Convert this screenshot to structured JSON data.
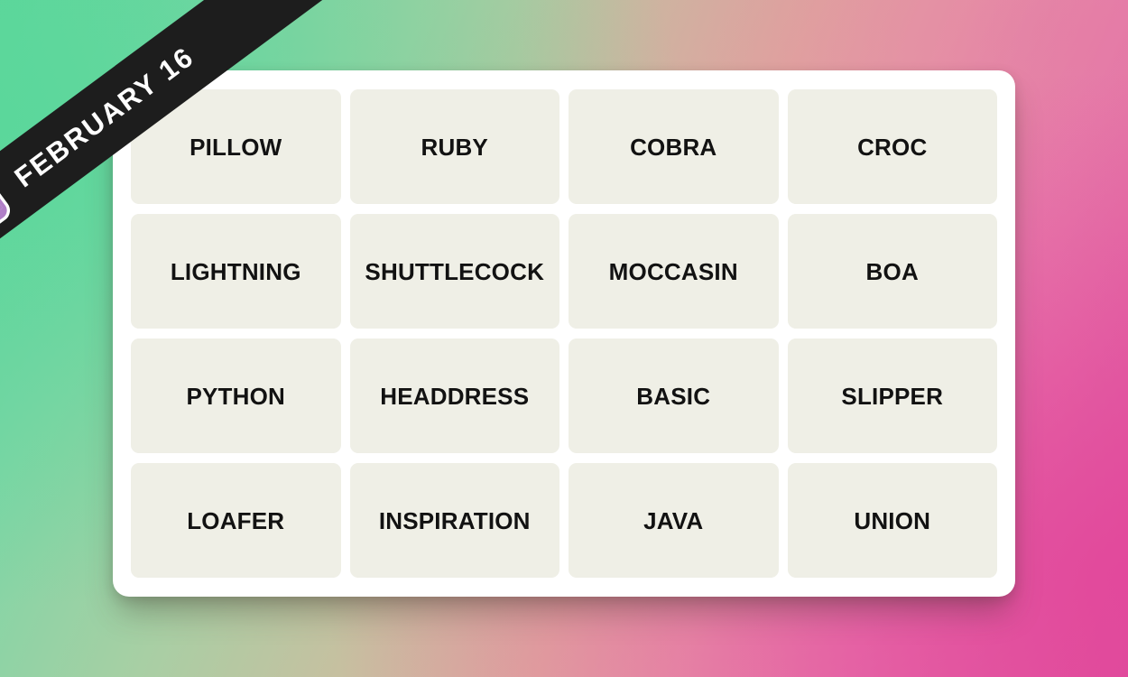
{
  "banner": {
    "date_label": "FEBRUARY 16",
    "icon": "connections-grid-icon",
    "background_color": "#1d1d1d",
    "text_color": "#ffffff",
    "icon_accent_color": "#b07fc7"
  },
  "background": {
    "gradient_start_color": "#5fd69a",
    "gradient_mid_color": "#dfae9f",
    "gradient_end_color": "#dd4f9c"
  },
  "card": {
    "background_color": "#ffffff",
    "tile_background_color": "#efefe6",
    "tile_text_color": "#121212"
  },
  "puzzle": {
    "rows": 4,
    "columns": 4,
    "tiles": [
      {
        "label": "PILLOW"
      },
      {
        "label": "RUBY"
      },
      {
        "label": "COBRA"
      },
      {
        "label": "CROC"
      },
      {
        "label": "LIGHTNING"
      },
      {
        "label": "SHUTTLECOCK"
      },
      {
        "label": "MOCCASIN"
      },
      {
        "label": "BOA"
      },
      {
        "label": "PYTHON"
      },
      {
        "label": "HEADDRESS"
      },
      {
        "label": "BASIC"
      },
      {
        "label": "SLIPPER"
      },
      {
        "label": "LOAFER"
      },
      {
        "label": "INSPIRATION"
      },
      {
        "label": "JAVA"
      },
      {
        "label": "UNION"
      }
    ]
  }
}
